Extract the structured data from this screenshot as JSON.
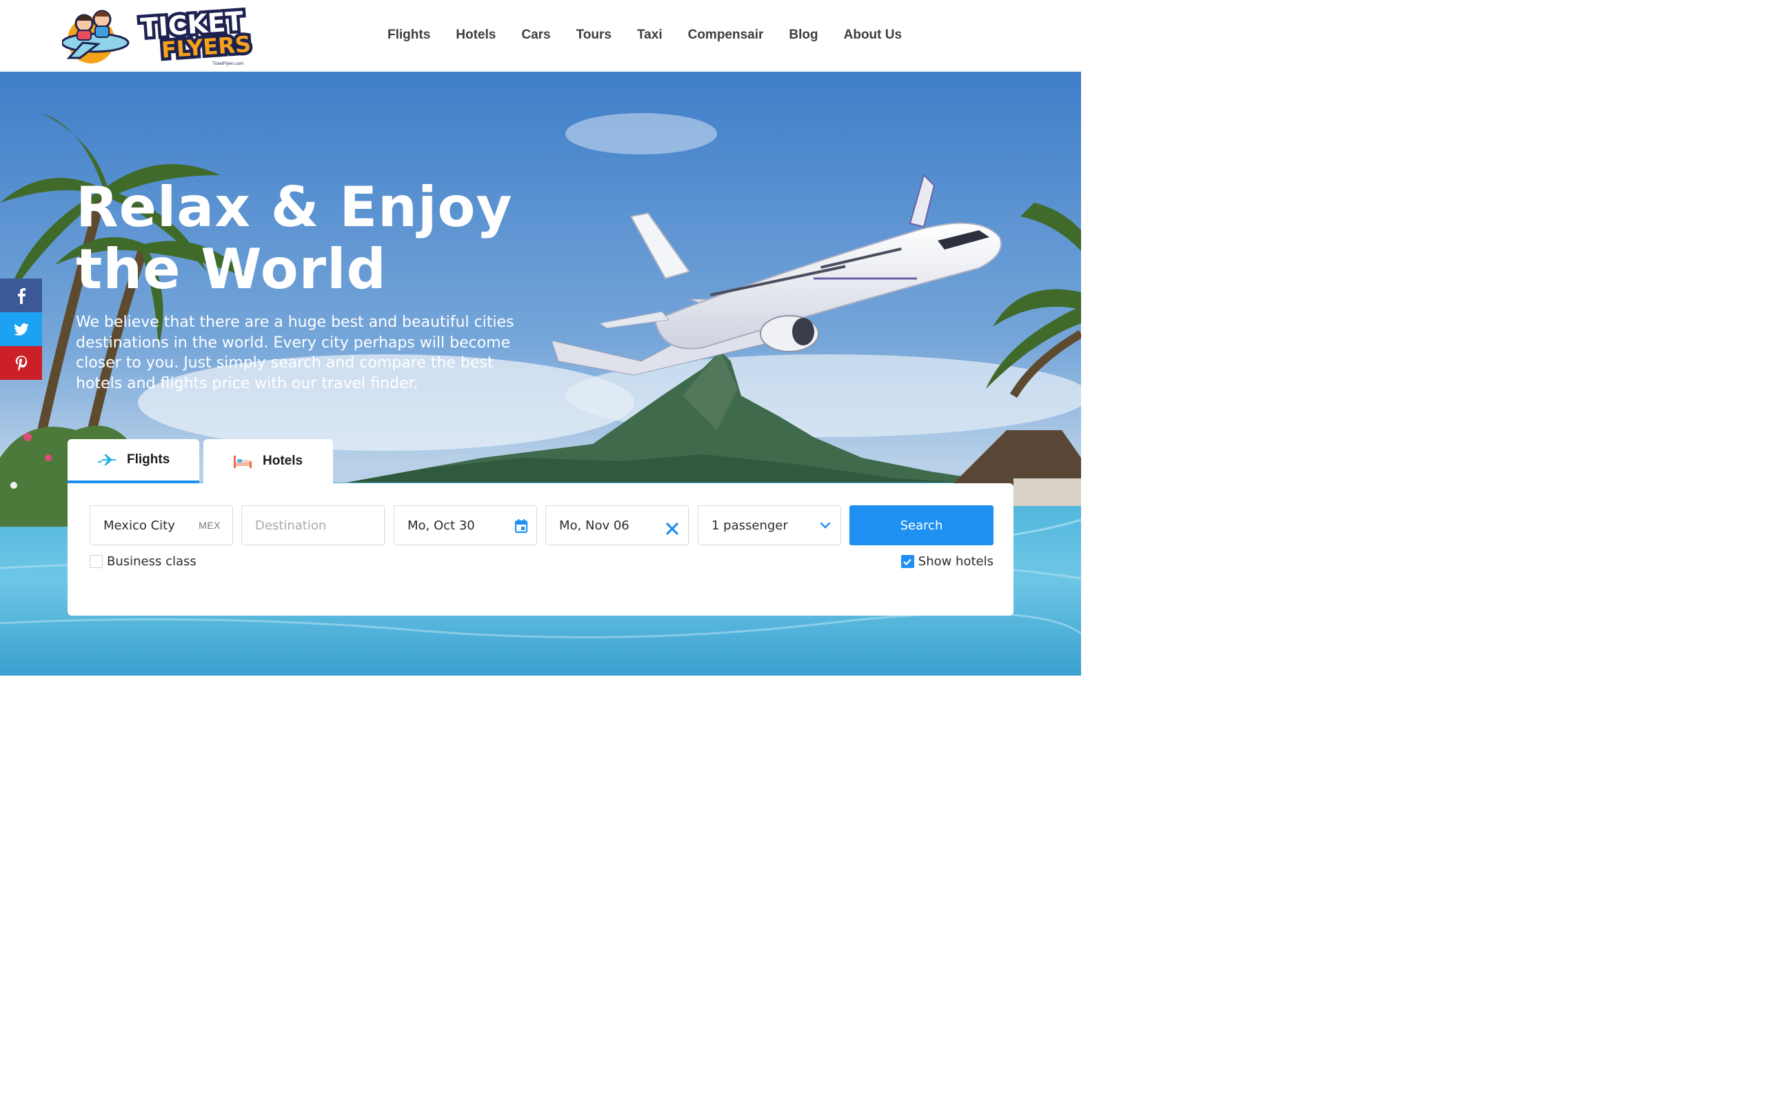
{
  "header": {
    "logo_text": "TICKET FLYERS",
    "logo_domain": "TicketFlyers.com",
    "nav": [
      {
        "label": "Flights"
      },
      {
        "label": "Hotels"
      },
      {
        "label": "Cars"
      },
      {
        "label": "Tours"
      },
      {
        "label": "Taxi"
      },
      {
        "label": "Compensair"
      },
      {
        "label": "Blog"
      },
      {
        "label": "About Us"
      }
    ]
  },
  "hero": {
    "title_line1": "Relax & Enjoy",
    "title_line2": "the World",
    "subtitle": "We believe that there are a huge best and beautiful cities destinations in the world. Every city perhaps will become closer to you. Just simply search and compare the best hotels and flights price with our travel finder."
  },
  "social": {
    "icons": [
      "facebook-icon",
      "twitter-icon",
      "pinterest-icon"
    ]
  },
  "search": {
    "tabs": [
      {
        "label": "Flights",
        "icon": "airplane-icon",
        "active": true
      },
      {
        "label": "Hotels",
        "icon": "bed-icon",
        "active": false
      }
    ],
    "origin": {
      "value": "Mexico City",
      "code": "MEX"
    },
    "destination": {
      "placeholder": "Destination"
    },
    "depart_date": "Mo, Oct 30",
    "return_date": "Mo, Nov 06",
    "passengers": "1 passenger",
    "search_label": "Search",
    "business_class": {
      "label": "Business class",
      "checked": false
    },
    "show_hotels": {
      "label": "Show hotels",
      "checked": true
    }
  },
  "colors": {
    "accent": "#1e90f2",
    "facebook": "#3b5898",
    "twitter": "#1da1f2",
    "pinterest": "#cb2027",
    "nav_text": "#3d3d3d"
  }
}
